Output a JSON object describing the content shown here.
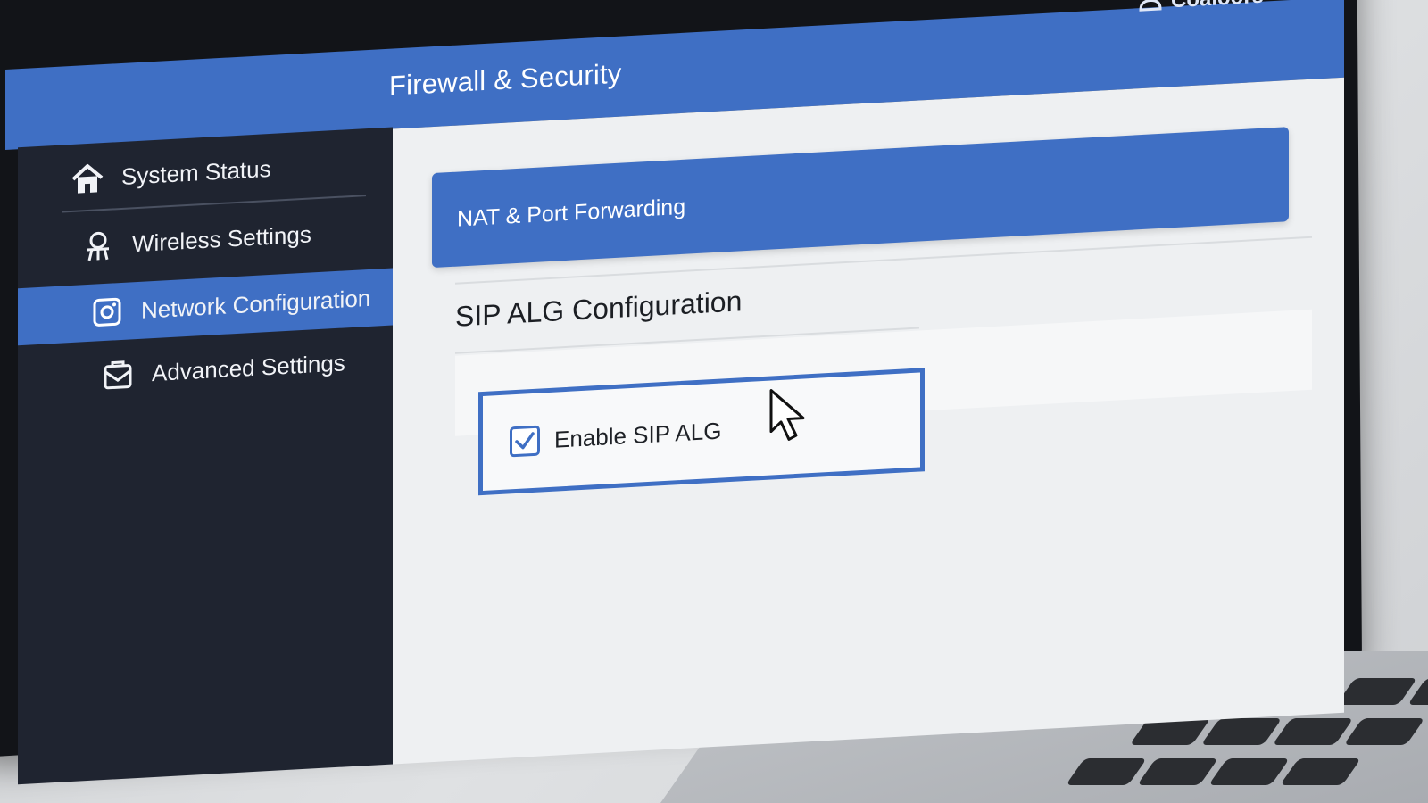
{
  "header": {
    "title": "Firewall & Security",
    "user_label": "Coaloors",
    "user_icon": "user-icon",
    "menu_icon": "hamburger-menu-icon"
  },
  "sidebar": {
    "items": [
      {
        "label": "System Status",
        "icon": "home-icon",
        "active": false
      },
      {
        "label": "Wireless Settings",
        "icon": "wireless-icon",
        "active": false
      },
      {
        "label": "Network Configuration",
        "icon": "network-config-icon",
        "active": true
      },
      {
        "label": "Advanced Settings",
        "icon": "advanced-settings-icon",
        "active": false
      }
    ]
  },
  "main": {
    "banner_label": "NAT & Port Forwarding",
    "section_title": "SIP ALG Configuration",
    "sip_checkbox": {
      "label": "Enable SIP ALG",
      "checked": true
    }
  },
  "colors": {
    "accent": "#3f6fc4",
    "sidebar_bg": "#1f2430",
    "content_bg": "#eef0f2"
  }
}
